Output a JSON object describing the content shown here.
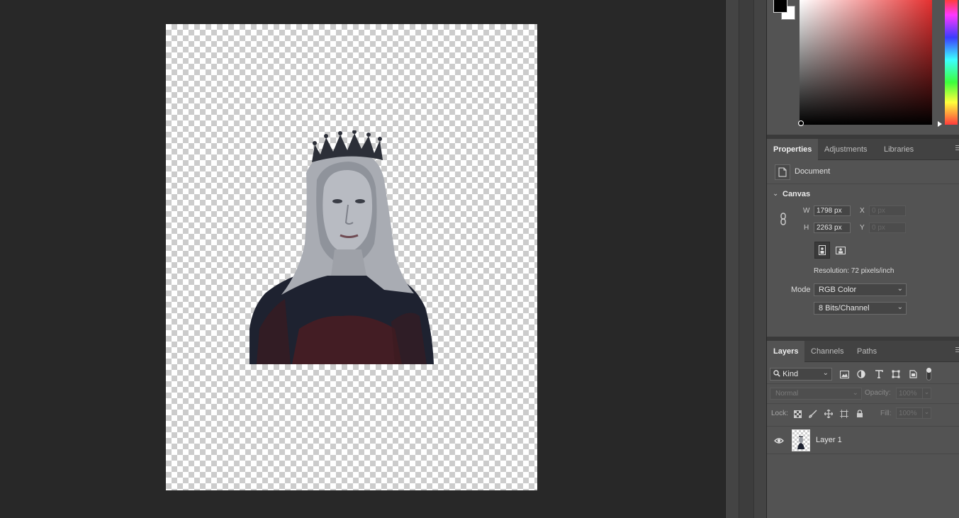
{
  "properties_panel": {
    "tabs": [
      "Properties",
      "Adjustments",
      "Libraries"
    ],
    "active_tab": "Properties",
    "document_label": "Document",
    "canvas_section": {
      "title": "Canvas",
      "width_label": "W",
      "width_value": "1798 px",
      "height_label": "H",
      "height_value": "2263 px",
      "x_label": "X",
      "x_placeholder": "0 px",
      "y_label": "Y",
      "y_placeholder": "0 px",
      "resolution": "Resolution: 72 pixels/inch",
      "mode_label": "Mode",
      "mode_value": "RGB Color",
      "bit_depth_value": "8 Bits/Channel"
    }
  },
  "layers_panel": {
    "tabs": [
      "Layers",
      "Channels",
      "Paths"
    ],
    "active_tab": "Layers",
    "filter_kind": "Kind",
    "blend_mode": "Normal",
    "opacity_label": "Opacity:",
    "opacity_value": "100%",
    "lock_label": "Lock:",
    "fill_label": "Fill:",
    "fill_value": "100%",
    "layers": [
      {
        "name": "Layer 1",
        "visible": true
      }
    ]
  },
  "colors": {
    "foreground": "#000000",
    "background": "#ffffff",
    "hue": "#e53030"
  },
  "icons": {
    "document": "document-icon",
    "link": "chain-link-icon",
    "eye": "eye-icon",
    "search": "search-icon"
  }
}
